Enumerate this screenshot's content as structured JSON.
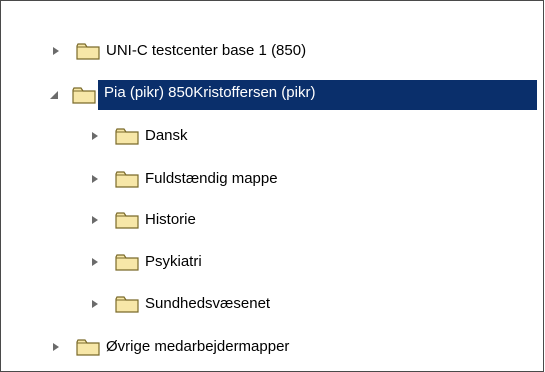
{
  "tree": {
    "root_items": [
      {
        "label": "UNI-C testcenter base 1 (850)",
        "expanded": false
      },
      {
        "label": "Pia (pikr) 850Kristoffersen (pikr)",
        "expanded": true,
        "selected": true
      },
      {
        "label": "Øvrige medarbejdermapper",
        "expanded": false
      }
    ],
    "children": [
      {
        "label": "Dansk",
        "expanded": false
      },
      {
        "label": "Fuldstændig mappe",
        "expanded": false
      },
      {
        "label": "Historie",
        "expanded": false
      },
      {
        "label": "Psykiatri",
        "expanded": false
      },
      {
        "label": "Sundhedsvæsenet",
        "expanded": false
      }
    ]
  },
  "colors": {
    "selection_bg": "#0a2f6b",
    "folder_fill": "#f7e7a8",
    "folder_stroke": "#7a6a2a",
    "expander": "#6b6b6b"
  },
  "icons": {
    "collapsed": "chevron-right-icon",
    "expanded": "chevron-down-icon",
    "folder": "folder-icon"
  }
}
